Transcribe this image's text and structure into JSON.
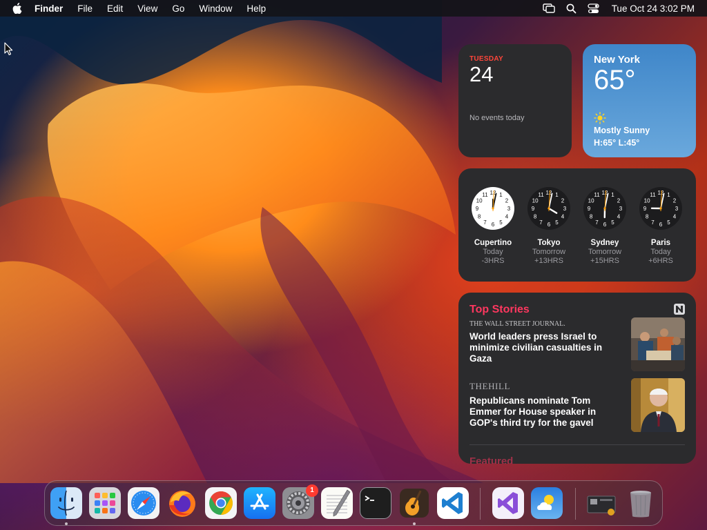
{
  "menubar": {
    "app_name": "Finder",
    "items": [
      "File",
      "Edit",
      "View",
      "Go",
      "Window",
      "Help"
    ],
    "datetime": "Tue Oct 24  3:02 PM"
  },
  "calendar_widget": {
    "weekday": "TUESDAY",
    "date": "24",
    "events": "No events today"
  },
  "weather_widget": {
    "city": "New York",
    "temperature": "65°",
    "condition": "Mostly Sunny",
    "high_low": "H:65° L:45°",
    "icon": "sun-icon"
  },
  "world_clock_widget": {
    "clocks": [
      {
        "city": "Cupertino",
        "day": "Today",
        "offset": "-3HRS",
        "time": "12:02",
        "face": "light"
      },
      {
        "city": "Tokyo",
        "day": "Tomorrow",
        "offset": "+13HRS",
        "time": "4:02",
        "face": "dark"
      },
      {
        "city": "Sydney",
        "day": "Tomorrow",
        "offset": "+15HRS",
        "time": "6:02",
        "face": "dark"
      },
      {
        "city": "Paris",
        "day": "Today",
        "offset": "+6HRS",
        "time": "9:02",
        "face": "dark"
      }
    ]
  },
  "news_widget": {
    "title": "Top Stories",
    "stories": [
      {
        "source": "THE WALL STREET JOURNAL.",
        "headline": "World leaders press Israel to minimize civilian casualties in Gaza"
      },
      {
        "source": "THEHILL",
        "headline": "Republicans nominate Tom Emmer for House speaker in GOP's third try for the gavel"
      }
    ],
    "featured_label": "Featured"
  },
  "dock": {
    "apps": [
      {
        "name": "Finder",
        "icon": "finder-icon",
        "running": true
      },
      {
        "name": "Launchpad",
        "icon": "launchpad-icon",
        "running": false
      },
      {
        "name": "Safari",
        "icon": "safari-icon",
        "running": false
      },
      {
        "name": "Firefox",
        "icon": "firefox-icon",
        "running": false
      },
      {
        "name": "Google Chrome",
        "icon": "chrome-icon",
        "running": false
      },
      {
        "name": "App Store",
        "icon": "app-store-icon",
        "running": false
      },
      {
        "name": "System Settings",
        "icon": "settings-icon",
        "running": false,
        "badge": "1"
      },
      {
        "name": "TextEdit",
        "icon": "textedit-icon",
        "running": false
      },
      {
        "name": "Terminal",
        "icon": "terminal-icon",
        "running": false
      },
      {
        "name": "GarageBand",
        "icon": "garageband-icon",
        "running": true
      },
      {
        "name": "Visual Studio Code",
        "icon": "vscode-icon",
        "running": false
      },
      {
        "name": "Visual Studio",
        "icon": "visual-studio-icon",
        "running": false
      },
      {
        "name": "Weather",
        "icon": "weather-icon",
        "running": false
      },
      {
        "name": "Screenshot Folder",
        "icon": "folder-stack-icon",
        "running": false
      },
      {
        "name": "Trash",
        "icon": "trash-icon",
        "running": false
      }
    ]
  }
}
